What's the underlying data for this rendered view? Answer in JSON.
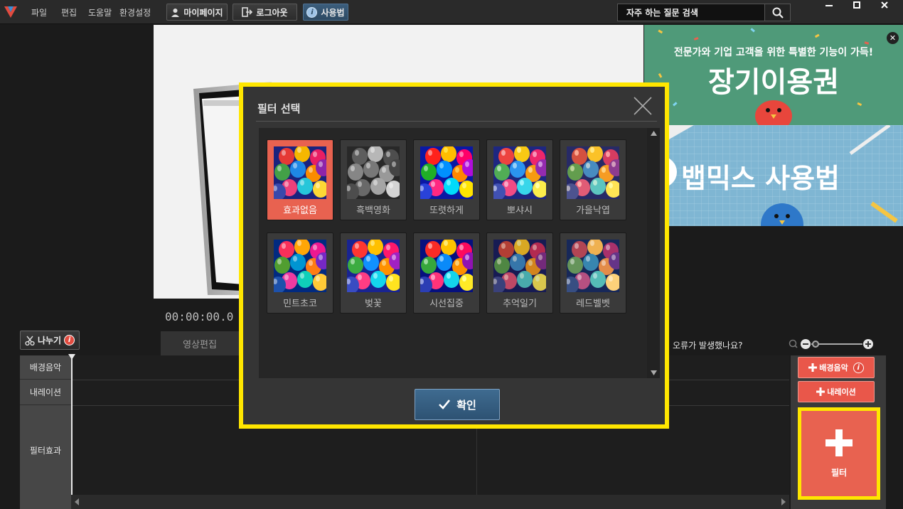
{
  "menu": [
    "파일",
    "편집",
    "도움말",
    "환경설정"
  ],
  "toolbar": {
    "mypage_label": "마이페이지",
    "logout_label": "로그아웃",
    "howto_label": "사용법"
  },
  "search": {
    "placeholder": "자주 하는 질문 검색"
  },
  "preview": {
    "timecode": "00:00:00.0"
  },
  "ads": {
    "ad1_sub": "전문가와 기업 고객을 위한 특별한 기능이 가득!",
    "ad1_title": "장기이용권",
    "ad2_title": "뱁믹스 사용법",
    "close_glyph": "✕"
  },
  "editor": {
    "split_label": "나누기",
    "tab_edit": "영상편집",
    "error_question": "오류가 발생했나요?",
    "tracks": [
      "배경음악",
      "내레이션",
      "필터효과"
    ],
    "add_bgm": "배경음악",
    "add_narration": "내레이션",
    "filter_label": "필터"
  },
  "modal": {
    "title": "필터 선택",
    "ok_label": "확인",
    "selected_index": 0,
    "filters": [
      "효과없음",
      "흑백영화",
      "또렷하게",
      "뽀샤시",
      "가을낙엽",
      "민트초코",
      "벚꽃",
      "시선집중",
      "추억일기",
      "레드벨벳"
    ]
  },
  "colors": {
    "accent_red": "#e86250",
    "highlight_yellow": "#ffe600",
    "button_blue": "#3f6b90"
  }
}
